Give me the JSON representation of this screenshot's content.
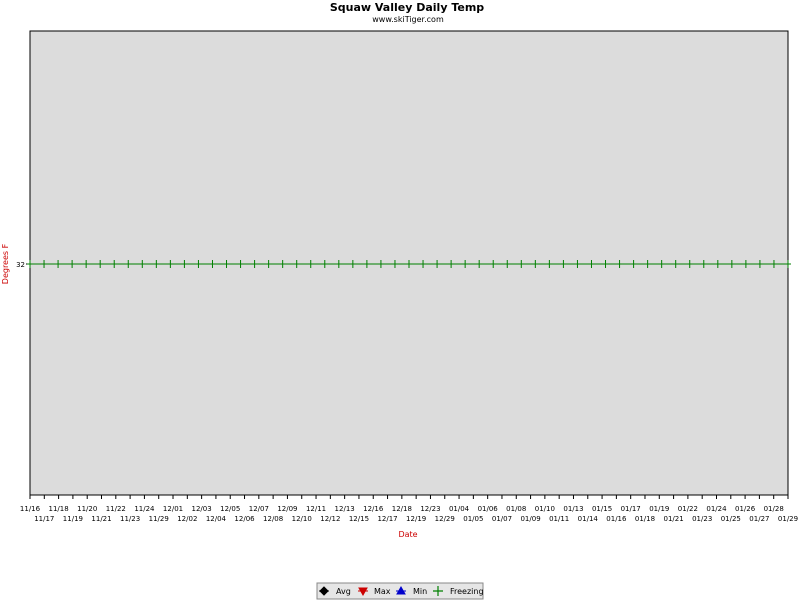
{
  "chart_data": {
    "type": "line",
    "title": "Squaw Valley Daily Temp",
    "subtitle": "www.skiTiger.com",
    "xlabel": "Date",
    "ylabel": "Degrees F",
    "y_ticks": [
      "32"
    ],
    "x_ticks_row1": [
      "11/16",
      "11/18",
      "11/20",
      "11/22",
      "11/24",
      "12/01",
      "12/03",
      "12/05",
      "12/07",
      "12/09",
      "12/11",
      "12/13",
      "12/16",
      "12/18",
      "12/23",
      "01/04",
      "01/06",
      "01/08",
      "01/10",
      "01/13",
      "01/15",
      "01/17",
      "01/19",
      "01/22",
      "01/24",
      "01/26",
      "01/28"
    ],
    "x_ticks_row2": [
      "11/17",
      "11/19",
      "11/21",
      "11/23",
      "11/29",
      "12/02",
      "12/04",
      "12/06",
      "12/08",
      "12/10",
      "12/12",
      "12/15",
      "12/17",
      "12/19",
      "12/29",
      "01/05",
      "01/07",
      "01/09",
      "01/11",
      "01/14",
      "01/16",
      "01/18",
      "01/21",
      "01/23",
      "01/25",
      "01/27",
      "01/29"
    ],
    "series": [
      {
        "name": "Avg",
        "color": "#000000",
        "marker": "diamond",
        "values": []
      },
      {
        "name": "Max",
        "color": "#cc0000",
        "marker": "triangle-down",
        "values": []
      },
      {
        "name": "Min",
        "color": "#0000cc",
        "marker": "triangle-up",
        "values": []
      },
      {
        "name": "Freezing",
        "color": "#008000",
        "marker": "plus",
        "values": [
          32,
          32,
          32,
          32,
          32,
          32,
          32,
          32,
          32,
          32,
          32,
          32,
          32,
          32,
          32,
          32,
          32,
          32,
          32,
          32,
          32,
          32,
          32,
          32,
          32,
          32,
          32,
          32,
          32,
          32,
          32,
          32,
          32,
          32,
          32,
          32,
          32,
          32,
          32,
          32,
          32,
          32,
          32,
          32,
          32,
          32,
          32,
          32,
          32,
          32,
          32,
          32,
          32,
          32,
          32
        ]
      }
    ],
    "legend_position": "bottom-center",
    "plot_background": "#dcdcdc"
  }
}
